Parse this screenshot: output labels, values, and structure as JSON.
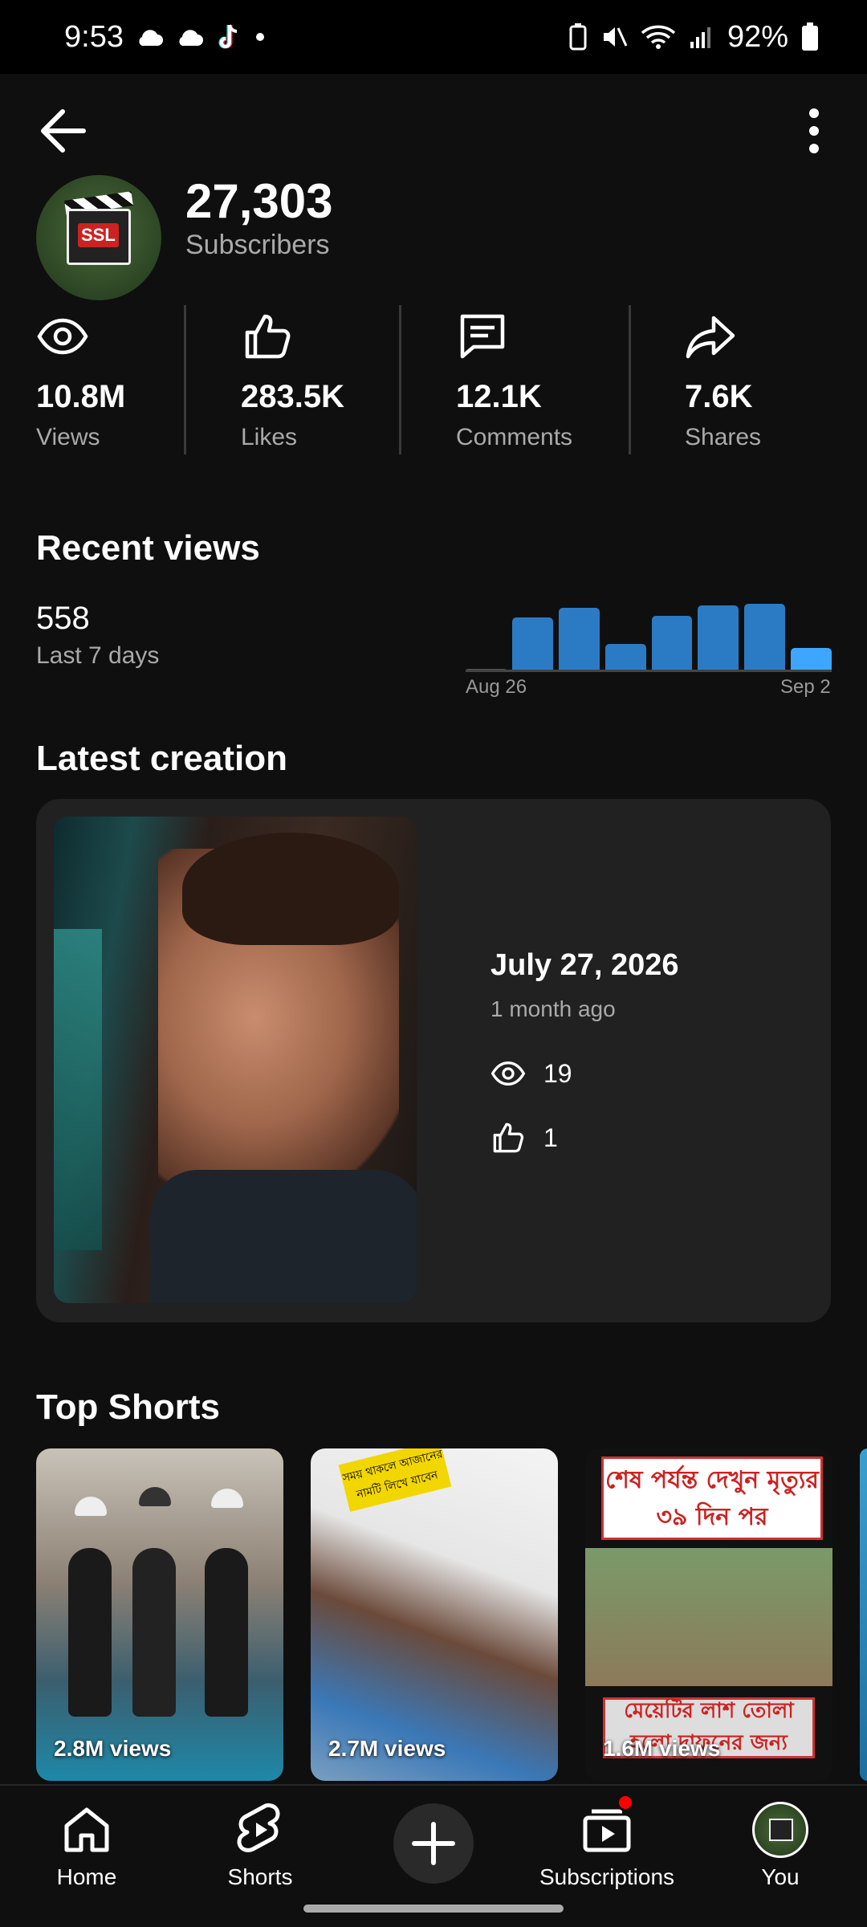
{
  "status": {
    "time": "9:53",
    "battery": "92%"
  },
  "channel": {
    "subscriber_count": "27,303",
    "subscriber_label": "Subscribers",
    "avatar_text": "SSL"
  },
  "stats": [
    {
      "icon": "eye-icon",
      "value": "10.8M",
      "label": "Views"
    },
    {
      "icon": "thumb-up-icon",
      "value": "283.5K",
      "label": "Likes"
    },
    {
      "icon": "comment-icon",
      "value": "12.1K",
      "label": "Comments"
    },
    {
      "icon": "share-icon",
      "value": "7.6K",
      "label": "Shares"
    }
  ],
  "recent_views": {
    "title": "Recent views",
    "count": "558",
    "period": "Last 7 days",
    "start_label": "Aug 26",
    "end_label": "Sep 2"
  },
  "chart_data": {
    "type": "bar",
    "categories": [
      "Aug 26",
      "",
      "",
      "",
      "",
      "",
      "",
      "Sep 2"
    ],
    "values": [
      2,
      70,
      82,
      35,
      72,
      85,
      88,
      30
    ],
    "highlight_last": true,
    "colors": {
      "bar": "#2b7bc4",
      "current": "#3ea6ff"
    }
  },
  "latest_creation": {
    "title": "Latest creation",
    "date": "July 27, 2026",
    "ago": "1 month ago",
    "views": "19",
    "likes": "1"
  },
  "top_shorts": {
    "title": "Top Shorts",
    "items": [
      {
        "views": "2.8M views"
      },
      {
        "views": "2.7M views",
        "sticker": "সময় থাকলে আজানের নামটি লিখে যাবেন"
      },
      {
        "views": "1.6M views",
        "banner_top": "শেষ পর্যন্ত দেখুন মৃত্যুর ৩৯ দিন পর",
        "banner_bottom": "মেয়েটির লাশ তোলা হলো দাফনের জন্য"
      }
    ]
  },
  "nav": {
    "home": "Home",
    "shorts": "Shorts",
    "subscriptions": "Subscriptions",
    "you": "You"
  }
}
